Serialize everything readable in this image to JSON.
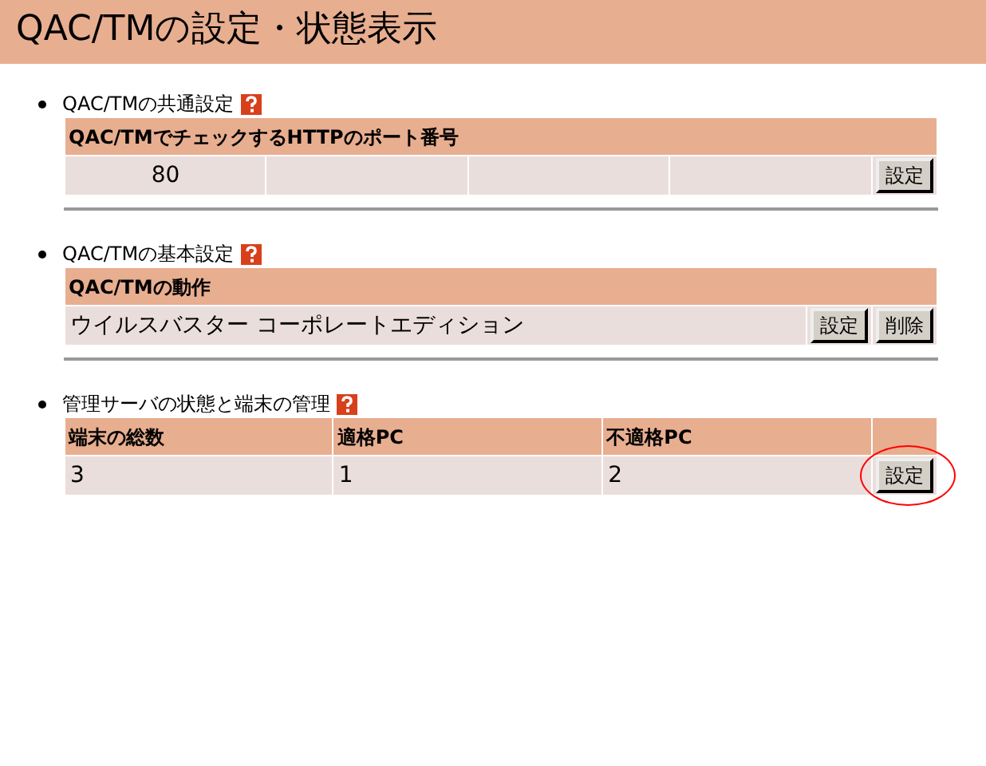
{
  "title": "QAC/TMの設定・状態表示",
  "sections": [
    {
      "kind": "port",
      "title": "QAC/TMの共通設定",
      "columns": [
        "QAC/TMでチェックするHTTPのポート番号"
      ],
      "cells": [
        "80"
      ],
      "buttons": [
        {
          "label": "設定",
          "highlighted": false
        }
      ]
    },
    {
      "kind": "action",
      "title": "QAC/TMの基本設定",
      "columns": [
        "QAC/TMの動作"
      ],
      "cells": [
        "ウイルスバスター コーポレートエディション"
      ],
      "buttons": [
        {
          "label": "設定",
          "highlighted": false
        },
        {
          "label": "削除",
          "highlighted": false
        }
      ]
    },
    {
      "kind": "stats",
      "title": "管理サーバの状態と端末の管理",
      "columns": [
        "端末の総数",
        "適格PC",
        "不適格PC"
      ],
      "cells": [
        "3",
        "1",
        "2"
      ],
      "buttons": [
        {
          "label": "設定",
          "highlighted": true
        }
      ]
    }
  ]
}
